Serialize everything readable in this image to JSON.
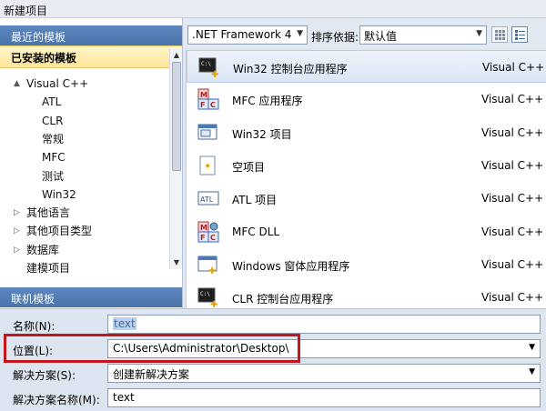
{
  "window": {
    "title": "新建项目"
  },
  "left_panel": {
    "recent_header": "最近的模板",
    "installed_header": "已安装的模板",
    "online_header": "联机模板",
    "tree": [
      {
        "label": "Visual C++",
        "level": 0,
        "arrow": "▲"
      },
      {
        "label": "ATL",
        "level": 1
      },
      {
        "label": "CLR",
        "level": 1
      },
      {
        "label": "常规",
        "level": 1
      },
      {
        "label": "MFC",
        "level": 1
      },
      {
        "label": "测试",
        "level": 1
      },
      {
        "label": "Win32",
        "level": 1
      },
      {
        "label": "其他语言",
        "level": 0,
        "arrow": "▷"
      },
      {
        "label": "其他项目类型",
        "level": 0,
        "arrow": "▷"
      },
      {
        "label": "数据库",
        "level": 0,
        "arrow": "▷"
      },
      {
        "label": "建模项目",
        "level": 0
      }
    ]
  },
  "toolbar": {
    "framework": ".NET Framework 4",
    "sort_label": "排序依据:",
    "sort_value": "默认值"
  },
  "templates": [
    {
      "name": "Win32 控制台应用程序",
      "lang": "Visual C++",
      "icon": "console-app-icon"
    },
    {
      "name": "MFC 应用程序",
      "lang": "Visual C++",
      "icon": "mfc-app-icon"
    },
    {
      "name": "Win32 项目",
      "lang": "Visual C++",
      "icon": "win32-project-icon"
    },
    {
      "name": "空项目",
      "lang": "Visual C++",
      "icon": "empty-project-icon"
    },
    {
      "name": "ATL 项目",
      "lang": "Visual C++",
      "icon": "atl-project-icon"
    },
    {
      "name": "MFC DLL",
      "lang": "Visual C++",
      "icon": "mfc-dll-icon"
    },
    {
      "name": "Windows 窗体应用程序",
      "lang": "Visual C++",
      "icon": "windows-forms-icon"
    },
    {
      "name": "CLR 控制台应用程序",
      "lang": "Visual C++",
      "icon": "clr-console-icon"
    }
  ],
  "form": {
    "name_label": "名称(N):",
    "name_value": "text",
    "location_label": "位置(L):",
    "location_value": "C:\\Users\\Administrator\\Desktop\\",
    "solution_label": "解决方案(S):",
    "solution_value": "创建新解决方案",
    "solution_name_label": "解决方案名称(M):",
    "solution_name_value": "text"
  },
  "colors": {
    "selection_highlight": "#c0171c",
    "header_blue": "#4a73aa",
    "installed_yellow": "#fde59a"
  }
}
